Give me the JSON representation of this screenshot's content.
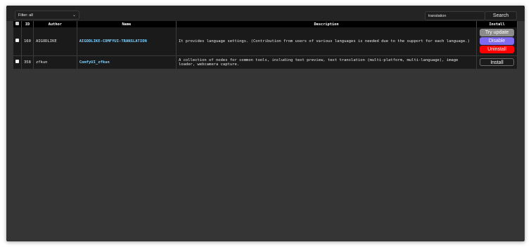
{
  "filter": {
    "label": "Filter: all"
  },
  "search": {
    "value": "translation",
    "button_label": "Search"
  },
  "table": {
    "headers": {
      "id": "ID",
      "author": "Author",
      "name": "Name",
      "description": "Description",
      "install": "Install"
    },
    "rows": [
      {
        "id": "160",
        "author": "AIGODLIKE",
        "name": "AIGODLIKE-COMFYUI-TRANSLATION",
        "description": "It provides language settings. (Contribution from users of various languages is needed due to the support for each language.)",
        "buttons": {
          "try_update": "Try update",
          "disable": "Disable",
          "uninstall": "Uninstall"
        }
      },
      {
        "id": "358",
        "author": "zfkun",
        "name": "ComfyUI_zfkun",
        "description": "A collection of nodes for common tools, including text preview, text translation (multi-platform, multi-language), image loader, webcamera capture.",
        "buttons": {
          "install": "Install"
        }
      }
    ]
  },
  "colors": {
    "background": "#353535",
    "header": "#000000",
    "row": "#1a1a1a",
    "link": "#7fd1ff",
    "try_update": "#8b8b8b",
    "disable": "#7f6bf0",
    "uninstall": "#ff0000"
  },
  "icons": {
    "filter_dropdown": "chevron-down-icon"
  }
}
